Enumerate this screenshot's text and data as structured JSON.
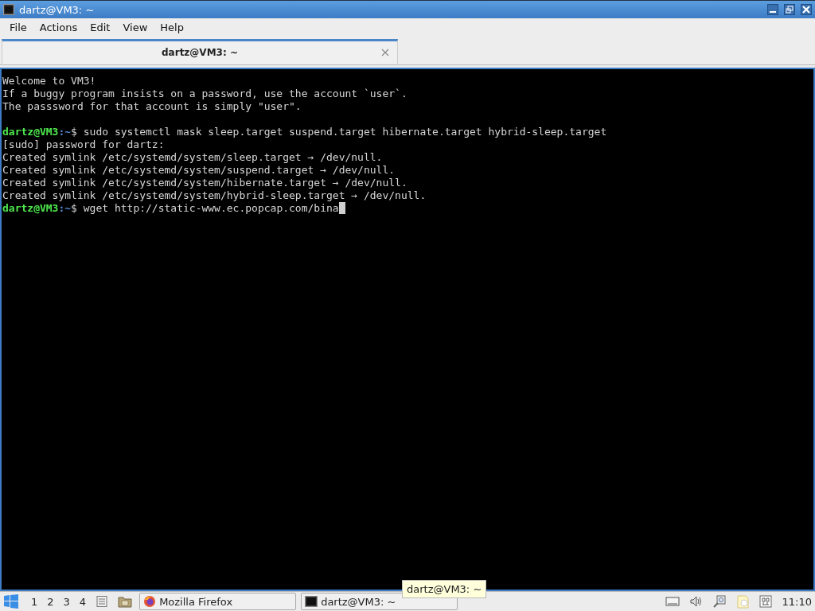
{
  "window": {
    "title": "dartz@VM3: ~"
  },
  "menu": [
    "File",
    "Actions",
    "Edit",
    "View",
    "Help"
  ],
  "tabs": [
    {
      "label": "dartz@VM3: ~",
      "selected": true
    }
  ],
  "terminal": {
    "lines": [
      {
        "kind": "output",
        "text": "Welcome to VM3!"
      },
      {
        "kind": "output",
        "text": "If a buggy program insists on a password, use the account `user`."
      },
      {
        "kind": "output",
        "text": "The passsword for that account is simply \"user\"."
      },
      {
        "kind": "blank"
      },
      {
        "kind": "prompt",
        "user": "dartz@VM3",
        "path": ":~",
        "text": "$ sudo systemctl mask sleep.target suspend.target hibernate.target hybrid-sleep.target"
      },
      {
        "kind": "output",
        "text": "[sudo] password for dartz:"
      },
      {
        "kind": "output",
        "text": "Created symlink /etc/systemd/system/sleep.target → /dev/null."
      },
      {
        "kind": "output",
        "text": "Created symlink /etc/systemd/system/suspend.target → /dev/null."
      },
      {
        "kind": "output",
        "text": "Created symlink /etc/systemd/system/hibernate.target → /dev/null."
      },
      {
        "kind": "output",
        "text": "Created symlink /etc/systemd/system/hybrid-sleep.target → /dev/null."
      },
      {
        "kind": "prompt",
        "user": "dartz@VM3",
        "path": ":~",
        "text": "$ wget http://static-www.ec.popcap.com/bina",
        "cursor": true
      }
    ]
  },
  "taskbar": {
    "workspaces": [
      "1",
      "2",
      "3",
      "4"
    ],
    "tasks": [
      {
        "label": "Mozilla Firefox",
        "kind": "browser"
      },
      {
        "label": "dartz@VM3: ~",
        "kind": "terminal"
      }
    ],
    "tooltip": "dartz@VM3: ~",
    "clock": "11:10"
  }
}
